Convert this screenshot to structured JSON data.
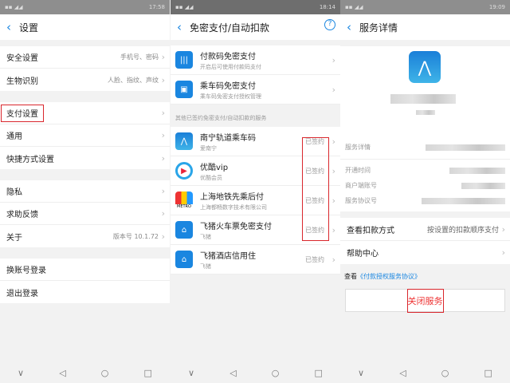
{
  "panels": [
    {
      "status": {
        "time": "17:58"
      },
      "title": "设置",
      "groups": [
        [
          {
            "label": "安全设置",
            "value": "手机号、密码"
          },
          {
            "label": "生物识别",
            "value": "人脸、指纹、声纹"
          }
        ],
        [
          {
            "label": "支付设置",
            "value": ""
          },
          {
            "label": "通用",
            "value": ""
          },
          {
            "label": "快捷方式设置",
            "value": ""
          }
        ],
        [
          {
            "label": "隐私",
            "value": ""
          },
          {
            "label": "求助反馈",
            "value": ""
          },
          {
            "label": "关于",
            "value": "版本号 10.1.72"
          }
        ],
        [
          {
            "label": "换账号登录",
            "value": ""
          },
          {
            "label": "退出登录",
            "value": ""
          }
        ]
      ]
    },
    {
      "status": {
        "time": "18:14"
      },
      "title": "免密支付/自动扣款",
      "top_items": [
        {
          "title": "付款码免密支付",
          "sub": "开启后可使用付款码支付",
          "icon": "barcode-icon"
        },
        {
          "title": "乘车码免密支付",
          "sub": "乘车码免密支付授权管理",
          "icon": "bus-icon"
        }
      ],
      "section": "其他已签约免密支付/自动扣款的服务",
      "services": [
        {
          "title": "南宁轨道乘车码",
          "sub": "爱南宁",
          "status": "已签约",
          "icon": "nanning-metro-icon"
        },
        {
          "title": "优酷vip",
          "sub": "优酷会员",
          "status": "已签约",
          "icon": "youku-icon"
        },
        {
          "title": "上海地铁先乘后付",
          "sub": "上海都畅数字技术有限公司",
          "status": "已签约",
          "icon": "metro-icon"
        },
        {
          "title": "飞猪火车票免密支付",
          "sub": "飞猪",
          "status": "已签约",
          "icon": "fliggy-icon"
        },
        {
          "title": "飞猪酒店信用住",
          "sub": "飞猪",
          "status": "已签约",
          "icon": "fliggy-icon"
        }
      ],
      "metro_logo": "METRO"
    },
    {
      "status": {
        "time": "19:09"
      },
      "title": "服务详情",
      "detail_label": "服务详情",
      "fields": [
        "开通时间",
        "商户端账号",
        "服务协议号"
      ],
      "deduct": {
        "label": "查看扣款方式",
        "value": "按设置的扣款顺序支付"
      },
      "help": "帮助中心",
      "view": "查看",
      "agreement": "《付款授权服务协议》",
      "close": "关闭服务"
    }
  ],
  "colors": {
    "accent": "#1a86e0",
    "highlight": "#d9262c"
  }
}
